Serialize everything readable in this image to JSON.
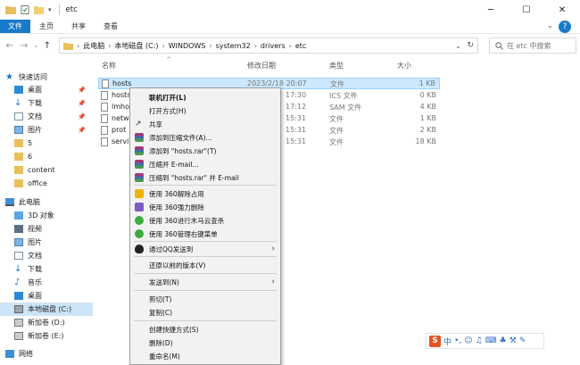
{
  "window": {
    "title": "etc"
  },
  "ribbon": {
    "tabs": [
      "文件",
      "主页",
      "共享",
      "查看"
    ],
    "help": "?"
  },
  "address": {
    "crumbs": [
      "此电脑",
      "本地磁盘 (C:)",
      "WINDOWS",
      "system32",
      "drivers",
      "etc"
    ],
    "search_placeholder": "在 etc 中搜索"
  },
  "nav_pane": {
    "items": [
      {
        "label": "快速访问"
      },
      {
        "label": "桌面"
      },
      {
        "label": "下载"
      },
      {
        "label": "文档"
      },
      {
        "label": "图片"
      },
      {
        "label": "5"
      },
      {
        "label": "6"
      },
      {
        "label": "content"
      },
      {
        "label": "office"
      },
      {
        "label": "此电脑"
      },
      {
        "label": "3D 对象"
      },
      {
        "label": "视频"
      },
      {
        "label": "图片"
      },
      {
        "label": "文档"
      },
      {
        "label": "下载"
      },
      {
        "label": "音乐"
      },
      {
        "label": "桌面"
      },
      {
        "label": "本地磁盘 (C:)"
      },
      {
        "label": "新加卷 (D:)"
      },
      {
        "label": "新加卷 (E:)"
      },
      {
        "label": "网络"
      }
    ]
  },
  "columns": {
    "name": "名称",
    "date": "修改日期",
    "type": "类型",
    "size": "大小"
  },
  "files": [
    {
      "name": "hosts",
      "date": "2023/2/18 20:07",
      "type": "文件",
      "size": "1 KB"
    },
    {
      "name": "hosts",
      "date": "17:30",
      "type": "ICS 文件",
      "size": "0 KB"
    },
    {
      "name": "lmho",
      "date": "17:12",
      "type": "SAM 文件",
      "size": "4 KB"
    },
    {
      "name": "netw",
      "date": "15:31",
      "type": "文件",
      "size": "1 KB"
    },
    {
      "name": "prot",
      "date": "15:31",
      "type": "文件",
      "size": "2 KB"
    },
    {
      "name": "servi",
      "date": "15:31",
      "type": "文件",
      "size": "18 KB"
    }
  ],
  "context_menu": {
    "items": [
      {
        "label": "联机打开(L)",
        "bold": true
      },
      {
        "label": "打开方式(H)"
      },
      {
        "label": "共享",
        "icon": "share"
      },
      {
        "label": "添加到压缩文件(A)...",
        "icon": "winrar"
      },
      {
        "label": "添加到 \"hosts.rar\"(T)",
        "icon": "winrar"
      },
      {
        "label": "压缩并 E-mail...",
        "icon": "winrar"
      },
      {
        "label": "压缩到 \"hosts.rar\" 并 E-mail",
        "icon": "winrar"
      },
      {
        "label": "使用 360解除占用",
        "icon": "360"
      },
      {
        "label": "使用 360强力删除",
        "icon": "360"
      },
      {
        "label": "使用 360进行木马云查杀",
        "icon": "360g"
      },
      {
        "label": "使用 360管理右键菜单",
        "icon": "360g"
      },
      {
        "label": "通过QQ发送到",
        "icon": "qq",
        "submenu": true
      },
      {
        "label": "还原以前的版本(V)"
      },
      {
        "label": "发送到(N)",
        "submenu": true
      },
      {
        "label": "剪切(T)"
      },
      {
        "label": "复制(C)"
      },
      {
        "label": "创建快捷方式(S)"
      },
      {
        "label": "删除(D)"
      },
      {
        "label": "重命名(M)"
      }
    ]
  },
  "ime": {
    "logo": "S",
    "mode": "中"
  }
}
